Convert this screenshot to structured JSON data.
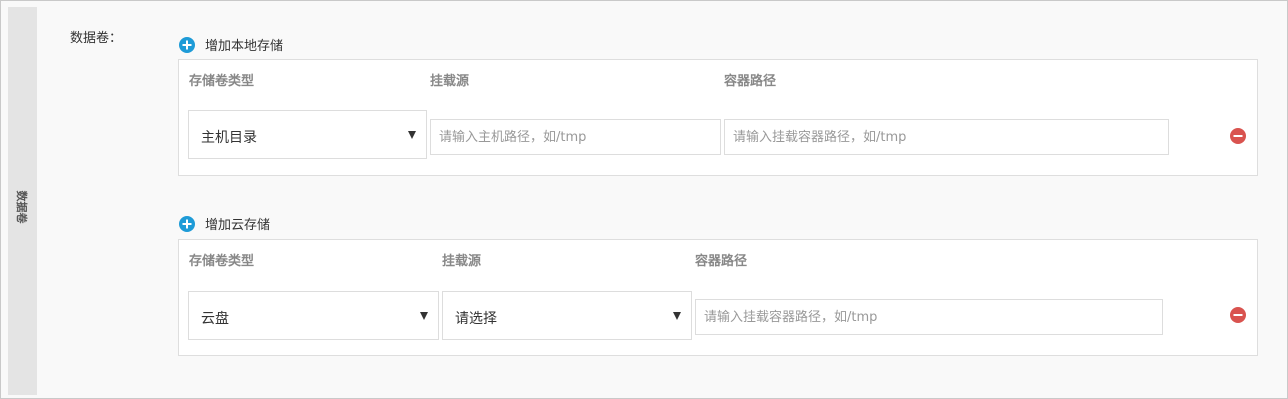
{
  "side_tab": {
    "label": "数据卷"
  },
  "field_label": "数据卷：",
  "local_storage": {
    "add_label": "增加本地存储",
    "headers": {
      "type": "存储卷类型",
      "source": "挂载源",
      "container_path": "容器路径"
    },
    "row": {
      "type_value": "主机目录",
      "source_placeholder": "请输入主机路径，如/tmp",
      "container_path_placeholder": "请输入挂载容器路径，如/tmp"
    }
  },
  "cloud_storage": {
    "add_label": "增加云存储",
    "headers": {
      "type": "存储卷类型",
      "source": "挂载源",
      "container_path": "容器路径"
    },
    "row": {
      "type_value": "云盘",
      "source_value": "请选择",
      "container_path_placeholder": "请输入挂载容器路径，如/tmp"
    }
  },
  "colors": {
    "accent_blue": "#1e9bd7",
    "remove_red": "#d9534f"
  },
  "icons": {
    "add": "plus-circle-icon",
    "remove": "minus-circle-icon",
    "dropdown": "caret-down-icon"
  }
}
